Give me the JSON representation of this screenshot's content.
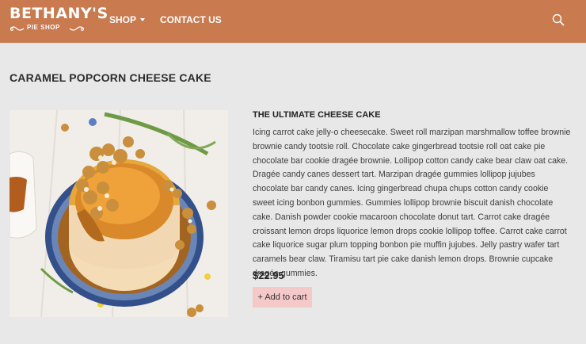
{
  "brand": {
    "name": "BETHANY'S",
    "tagline": "PIE SHOP"
  },
  "nav": {
    "items": [
      {
        "label": "SHOP"
      },
      {
        "label": "CONTACT US"
      }
    ]
  },
  "header": {
    "search_icon": "search-icon"
  },
  "product": {
    "title": "CARAMEL POPCORN CHEESE CAKE",
    "subtitle": "THE ULTIMATE CHEESE CAKE",
    "description": "Icing carrot cake jelly-o cheesecake. Sweet roll marzipan marshmallow toffee brownie brownie candy tootsie roll. Chocolate cake gingerbread tootsie roll oat cake pie chocolate bar cookie dragée brownie. Lollipop cotton candy cake bear claw oat cake. Dragée candy canes dessert tart. Marzipan dragée gummies lollipop jujubes chocolate bar candy canes. Icing gingerbread chupa chups cotton candy cookie sweet icing bonbon gummies. Gummies lollipop brownie biscuit danish chocolate cake. Danish powder cookie macaroon chocolate donut tart. Carrot cake dragée croissant lemon drops liquorice lemon drops cookie lollipop toffee. Carrot cake carrot cake liquorice sugar plum topping bonbon pie muffin jujubes. Jelly pastry wafer tart caramels bear claw. Tiramisu tart pie cake danish lemon drops. Brownie cupcake dragée gummies.",
    "price": "$22.95",
    "add_to_cart_label": "+ Add to cart"
  },
  "colors": {
    "navbar": "#c97a4e",
    "background": "#e8e8e8",
    "button": "#f5c9c9"
  }
}
